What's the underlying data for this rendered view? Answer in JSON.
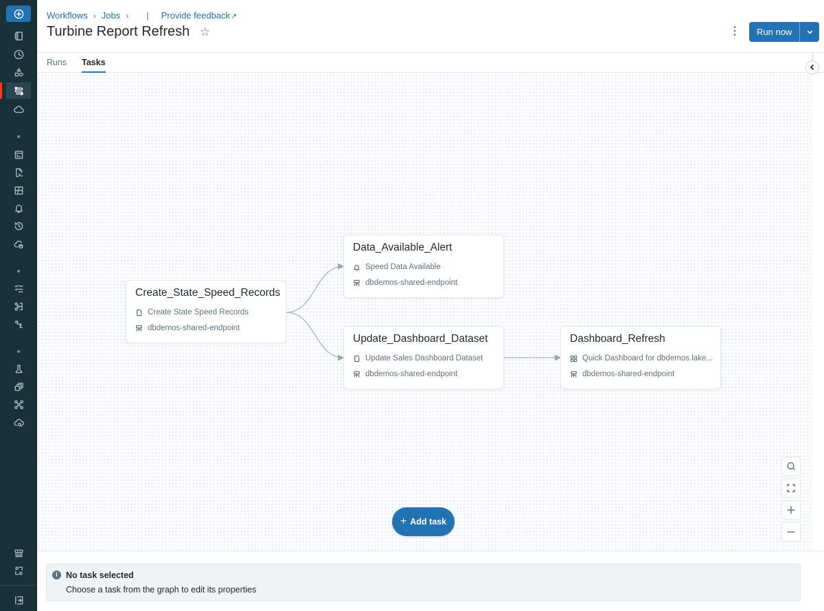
{
  "sidebar": {
    "items": [
      {
        "name": "new-icon"
      },
      {
        "name": "workspace-icon"
      },
      {
        "name": "recents-icon"
      },
      {
        "name": "catalog-icon"
      },
      {
        "name": "workflows-icon",
        "active": true
      },
      {
        "name": "compute-icon"
      },
      {
        "name": "sql-editor-icon"
      },
      {
        "name": "queries-icon"
      },
      {
        "name": "dashboards-icon"
      },
      {
        "name": "alerts-icon"
      },
      {
        "name": "query-history-icon"
      },
      {
        "name": "sql-warehouses-icon"
      },
      {
        "name": "job-runs-icon"
      },
      {
        "name": "data-ingestion-icon"
      },
      {
        "name": "pipelines-icon"
      },
      {
        "name": "experiments-icon"
      },
      {
        "name": "features-icon"
      },
      {
        "name": "models-icon"
      },
      {
        "name": "serving-icon"
      },
      {
        "name": "marketplace-icon"
      },
      {
        "name": "partner-connect-icon"
      },
      {
        "name": "collapse-sidebar-icon"
      }
    ],
    "accent_color": "#ff3621"
  },
  "header": {
    "breadcrumbs": [
      "Workflows",
      "Jobs"
    ],
    "feedback_link": "Provide feedback",
    "title": "Turbine Report Refresh",
    "run_now_label": "Run now"
  },
  "tabs": [
    {
      "label": "Runs",
      "active": false
    },
    {
      "label": "Tasks",
      "active": true
    }
  ],
  "graph": {
    "nodes": [
      {
        "id": "create",
        "title": "Create_State_Speed_Records",
        "task_icon": "notebook-icon",
        "task": "Create State Speed Records",
        "compute": "dbdemos-shared-endpoint"
      },
      {
        "id": "alert",
        "title": "Data_Available_Alert",
        "task_icon": "bell-icon",
        "task": "Speed Data Available",
        "compute": "dbdemos-shared-endpoint"
      },
      {
        "id": "update",
        "title": "Update_Dashboard_Dataset",
        "task_icon": "notebook-icon",
        "task": "Update Sales Dashboard Dataset",
        "compute": "dbdemos-shared-endpoint"
      },
      {
        "id": "refresh",
        "title": "Dashboard_Refresh",
        "task_icon": "dashboard-icon",
        "task": "Quick Dashboard for dbdemos.lake...",
        "compute": "dbdemos-shared-endpoint"
      }
    ],
    "edges": [
      {
        "from": "create",
        "to": "alert"
      },
      {
        "from": "create",
        "to": "update"
      },
      {
        "from": "update",
        "to": "refresh"
      }
    ],
    "add_task_label": "Add task",
    "edge_color": "#9fb6c8"
  },
  "details_panel": {
    "title": "No task selected",
    "description": "Choose a task from the graph to edit its properties"
  },
  "colors": {
    "primary": "#2272b4",
    "sidebar_bg": "#1b3139"
  }
}
